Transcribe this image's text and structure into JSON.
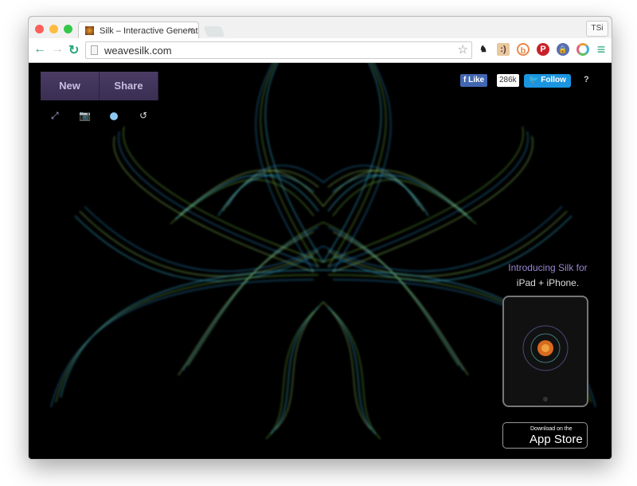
{
  "browser": {
    "tab_title": "Silk – Interactive Generative Art",
    "tab_close": "×",
    "profile": "TSi",
    "url": "weavesilk.com",
    "back": "←",
    "forward": "→",
    "reload": "↻",
    "star": "☆",
    "menu": "≡",
    "extensions": [
      "lamp-icon",
      "face-extension-icon",
      "b-extension-icon",
      "pinterest-icon",
      "lock-extension-icon",
      "color-wheel-icon"
    ]
  },
  "app": {
    "new_label": "New",
    "share_label": "Share",
    "tools": [
      "fullscreen-icon",
      "camera-icon",
      "color-dot-icon",
      "undo-icon"
    ],
    "fb_like": "Like",
    "fb_count": "286k",
    "tw_follow": "Follow",
    "help": "?",
    "promo_line1": "Introducing Silk for",
    "promo_line2": "iPad + iPhone.",
    "store_small": "Download on the",
    "store_big": "App Store",
    "colors": {
      "button": "#44385c",
      "accent": "#b9a6e0",
      "cyan": "#40d8ff",
      "green": "#7acc40"
    }
  }
}
